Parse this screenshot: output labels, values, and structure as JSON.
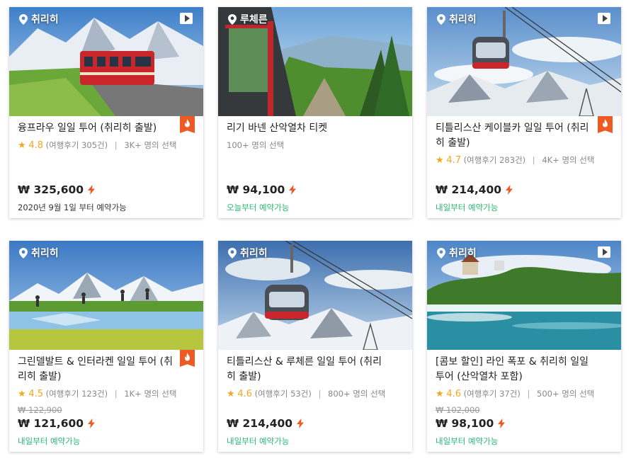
{
  "products": [
    {
      "location": "취리히",
      "has_video": true,
      "hot": true,
      "title": "융프라우 일일 투어 (취리히 출발)",
      "rating": "4.8",
      "reviews": "(여행후기 305건)",
      "popularity": "3K+ 명의 선택",
      "original_price": "",
      "price": "₩ 325,600",
      "instant": true,
      "availability": "2020년 9월 1일 부터 예약가능",
      "availability_color": "dark"
    },
    {
      "location": "루체른",
      "has_video": false,
      "hot": false,
      "title": "리기 바넨 산악열차 티켓",
      "rating": "",
      "reviews": "",
      "popularity": "100+ 명의 선택",
      "original_price": "",
      "price": "₩ 94,100",
      "instant": true,
      "availability": "오늘부터 예약가능",
      "availability_color": "green"
    },
    {
      "location": "취리히",
      "has_video": true,
      "hot": true,
      "title": "티틀리스산 케이블카 일일 투어 (취리히 출발)",
      "rating": "4.7",
      "reviews": "(여행후기 283건)",
      "popularity": "4K+ 명의 선택",
      "original_price": "",
      "price": "₩ 214,400",
      "instant": true,
      "availability": "내일부터 예약가능",
      "availability_color": "green"
    },
    {
      "location": "취리히",
      "has_video": false,
      "hot": true,
      "title": "그린델발트 & 인터라켄 일일 투어 (취리히 출발)",
      "rating": "4.5",
      "reviews": "(여행후기 123건)",
      "popularity": "1K+ 명의 선택",
      "original_price": "₩ 122,900",
      "price": "₩ 121,600",
      "instant": true,
      "availability": "내일부터 예약가능",
      "availability_color": "green"
    },
    {
      "location": "취리히",
      "has_video": false,
      "hot": false,
      "title": "티틀리스산 & 루체른 일일 투어 (취리히 출발)",
      "rating": "4.6",
      "reviews": "(여행후기 53건)",
      "popularity": "800+ 명의 선택",
      "original_price": "",
      "price": "₩ 214,400",
      "instant": true,
      "availability": "내일부터 예약가능",
      "availability_color": "green"
    },
    {
      "location": "취리히",
      "has_video": true,
      "hot": false,
      "title": "[콤보 할인] 라인 폭포 & 취리히 일일 투어 (산악열차 포함)",
      "rating": "4.6",
      "reviews": "(여행후기 37건)",
      "popularity": "500+ 명의 선택",
      "original_price": "₩ 102,000",
      "price": "₩ 98,100",
      "instant": true,
      "availability": "내일부터 예약가능",
      "availability_color": "green"
    }
  ],
  "colors": {
    "hot_badge": "#ee5a24",
    "rating_star": "#f5a623",
    "availability_green": "#2bb673",
    "instant_bolt": "#ee5a24"
  },
  "icons": {
    "location": "map-pin-icon",
    "video": "play-icon",
    "hot": "flame-icon",
    "rating": "star-icon",
    "instant": "lightning-icon"
  }
}
